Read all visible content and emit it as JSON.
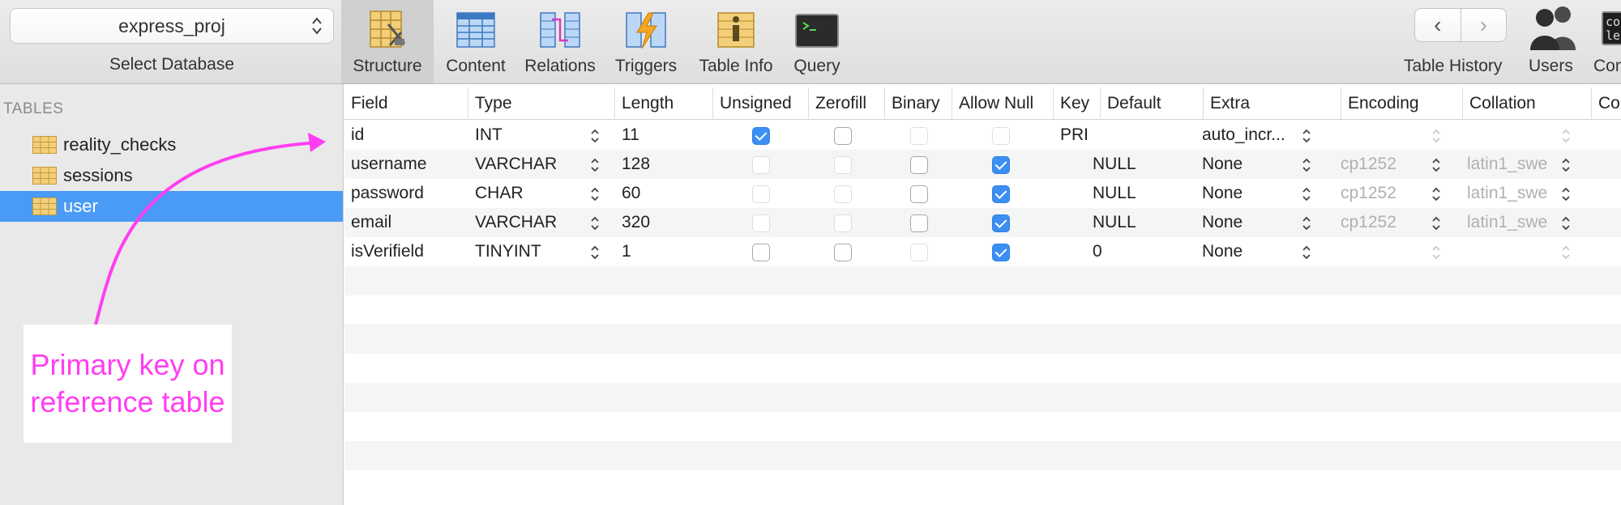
{
  "toolbar": {
    "database": "express_proj",
    "database_label": "Select Database",
    "tools": [
      {
        "label": "Structure",
        "icon": "structure-icon"
      },
      {
        "label": "Content",
        "icon": "content-icon"
      },
      {
        "label": "Relations",
        "icon": "relations-icon"
      },
      {
        "label": "Triggers",
        "icon": "triggers-icon"
      },
      {
        "label": "Table Info",
        "icon": "table-info-icon"
      },
      {
        "label": "Query",
        "icon": "query-icon"
      }
    ],
    "back": "‹",
    "forward": "›",
    "history_label": "Table History",
    "users_label": "Users",
    "console_label": "Con",
    "console_glyph": "co\nle"
  },
  "sidebar": {
    "header": "TABLES",
    "items": [
      "reality_checks",
      "sessions",
      "user"
    ],
    "selected": "user"
  },
  "annotation": {
    "text": "Primary key on reference table",
    "color": "#ff3ef2"
  },
  "table": {
    "columns": [
      "Field",
      "Type",
      "Length",
      "Unsigned",
      "Zerofill",
      "Binary",
      "Allow Null",
      "Key",
      "Default",
      "Extra",
      "Encoding",
      "Collation",
      "Com"
    ],
    "rows": [
      {
        "field": "id",
        "type": "INT",
        "length": "11",
        "unsigned": true,
        "zerofill": false,
        "binary": false,
        "allow_null": false,
        "key": "PRI",
        "default": "",
        "extra": "auto_incr...",
        "encoding": "",
        "collation": ""
      },
      {
        "field": "username",
        "type": "VARCHAR",
        "length": "128",
        "unsigned": false,
        "zerofill": false,
        "binary": false,
        "allow_null": true,
        "key": "",
        "default": "NULL",
        "extra": "None",
        "encoding": "cp1252",
        "collation": "latin1_swe"
      },
      {
        "field": "password",
        "type": "CHAR",
        "length": "60",
        "unsigned": false,
        "zerofill": false,
        "binary": false,
        "allow_null": true,
        "key": "",
        "default": "NULL",
        "extra": "None",
        "encoding": "cp1252",
        "collation": "latin1_swe"
      },
      {
        "field": "email",
        "type": "VARCHAR",
        "length": "320",
        "unsigned": false,
        "zerofill": false,
        "binary": false,
        "allow_null": true,
        "key": "",
        "default": "NULL",
        "extra": "None",
        "encoding": "cp1252",
        "collation": "latin1_swe"
      },
      {
        "field": "isVerifield",
        "type": "TINYINT",
        "length": "1",
        "unsigned": false,
        "zerofill": false,
        "binary": false,
        "allow_null": true,
        "key": "",
        "default": "0",
        "extra": "None",
        "encoding": "",
        "collation": ""
      }
    ]
  },
  "colors": {
    "selection": "#4a9bf5",
    "checkbox_checked": "#3b8ff3",
    "annotation": "#ff3ef2"
  }
}
